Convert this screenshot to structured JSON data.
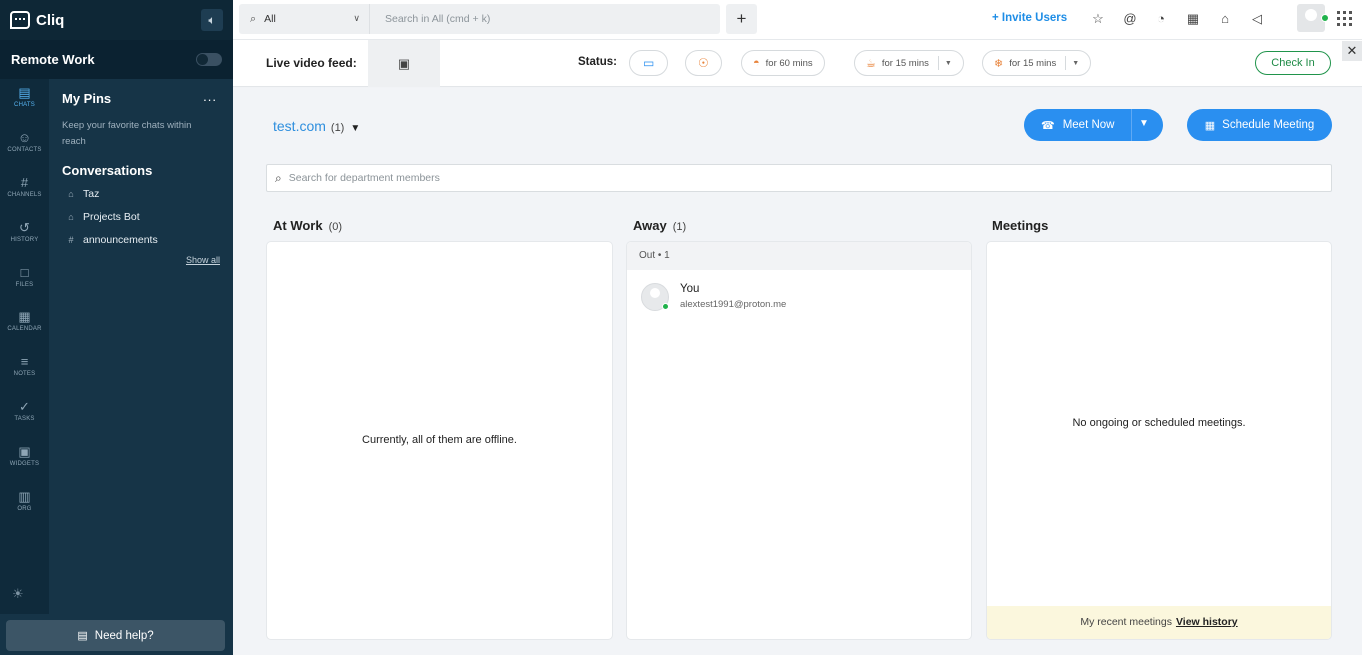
{
  "app": {
    "name": "Cliq",
    "workspace_mode_label": "Remote Work"
  },
  "rail": {
    "items": [
      {
        "label": "CHATS",
        "icon": "chat-icon"
      },
      {
        "label": "CONTACTS",
        "icon": "person-icon"
      },
      {
        "label": "CHANNELS",
        "icon": "hash-icon"
      },
      {
        "label": "HISTORY",
        "icon": "history-icon"
      },
      {
        "label": "FILES",
        "icon": "file-icon"
      },
      {
        "label": "CALENDAR",
        "icon": "calendar-icon"
      },
      {
        "label": "NOTES",
        "icon": "notes-icon"
      },
      {
        "label": "TASKS",
        "icon": "tasks-icon"
      },
      {
        "label": "WIDGETS",
        "icon": "widgets-icon"
      },
      {
        "label": "ORG",
        "icon": "org-icon"
      }
    ]
  },
  "panel": {
    "pins_title": "My Pins",
    "pins_more": "...",
    "pins_desc": "Keep your favorite chats within reach",
    "conversations_title": "Conversations",
    "conversations": [
      {
        "name": "Taz",
        "icon": "bot-icon"
      },
      {
        "name": "Projects Bot",
        "icon": "bot-icon"
      },
      {
        "name": "announcements",
        "icon": "hash-icon"
      }
    ],
    "show_all": "Show all"
  },
  "help": {
    "label": "Need help?"
  },
  "topbar": {
    "scope_value": "All",
    "search_placeholder": "Search in All (cmd + k)",
    "invite_label": "+ Invite Users"
  },
  "statusbar": {
    "live_label": "Live video feed:",
    "status_label": "Status:",
    "pills": [
      {
        "label": "for 60 mins",
        "icon": "lunch-icon"
      },
      {
        "label": "for 15 mins",
        "icon": "coffee-icon"
      },
      {
        "label": "for 15 mins",
        "icon": "break-icon"
      }
    ],
    "checkin_label": "Check In"
  },
  "main": {
    "department": "test.com",
    "department_count": "(1)",
    "meet_now_label": "Meet Now",
    "schedule_label": "Schedule Meeting",
    "search_placeholder": "Search for department members",
    "columns": {
      "at_work": {
        "title": "At Work",
        "count": "(0)",
        "message": "Currently, all of them are offline."
      },
      "away": {
        "title": "Away",
        "count": "(1)",
        "group_label": "Out • 1",
        "member": {
          "name": "You",
          "email": "alextest1991@proton.me"
        }
      },
      "meetings": {
        "title": "Meetings",
        "message": "No ongoing or scheduled meetings.",
        "recent_label": "My recent meetings",
        "view_history": "View history"
      }
    }
  },
  "colors": {
    "accent": "#2a8ff0",
    "sidebar": "#123042",
    "online": "#20b24b",
    "checkin": "#1d8a45"
  }
}
